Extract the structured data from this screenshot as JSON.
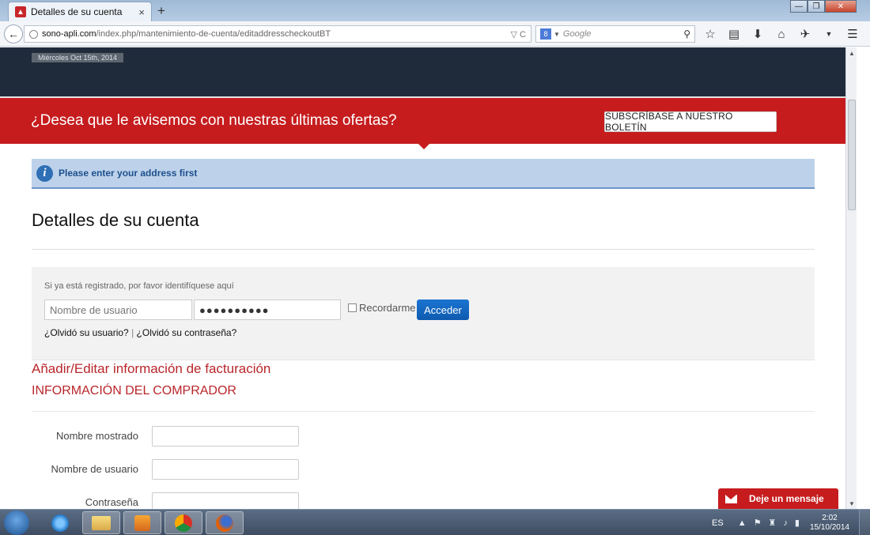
{
  "browser": {
    "tab_title": "Detalles de su cuenta",
    "tab_close": "×",
    "new_tab": "+",
    "url_domain": "sono-apli.com",
    "url_path": "/index.php/mantenimiento-de-cuenta/editaddresscheckoutBT",
    "url_controls": "▽ C",
    "search_placeholder": "Google",
    "window_controls": [
      "—",
      "❐",
      "✕"
    ]
  },
  "page": {
    "date": "Miércoles Oct 15th, 2014",
    "promo_text": "¿Desea que le avisemos con nuestras últimas ofertas?",
    "promo_button": "SUBSCRÍBASE A NUESTRO BOLETÍN",
    "info_message": "Please enter your address first",
    "title": "Detalles de su cuenta",
    "login": {
      "hint": "Si ya está registrado, por favor identifíquese aquí",
      "username_placeholder": "Nombre de usuario",
      "password_value": "●●●●●●●●●●",
      "remember_label": "Recordarme",
      "submit_label": "Acceder",
      "forgot_user": "¿Olvidó su usuario?",
      "separator": "|",
      "forgot_password": "¿Olvidó su contraseña?"
    },
    "billing_title": "Añadir/Editar información de facturación",
    "buyer_title": "INFORMACIÓN DEL COMPRADOR",
    "form_labels": {
      "display_name": "Nombre mostrado",
      "username": "Nombre de usuario",
      "password": "Contraseña"
    },
    "chat_button": "Deje un mensaje"
  },
  "taskbar": {
    "language": "ES",
    "time": "2:02",
    "date": "15/10/2014"
  },
  "colors": {
    "accent_red": "#c61c1e",
    "header_dark": "#1f2b3b",
    "info_blue": "#bdd2ea",
    "button_blue": "#0f5bb0"
  }
}
